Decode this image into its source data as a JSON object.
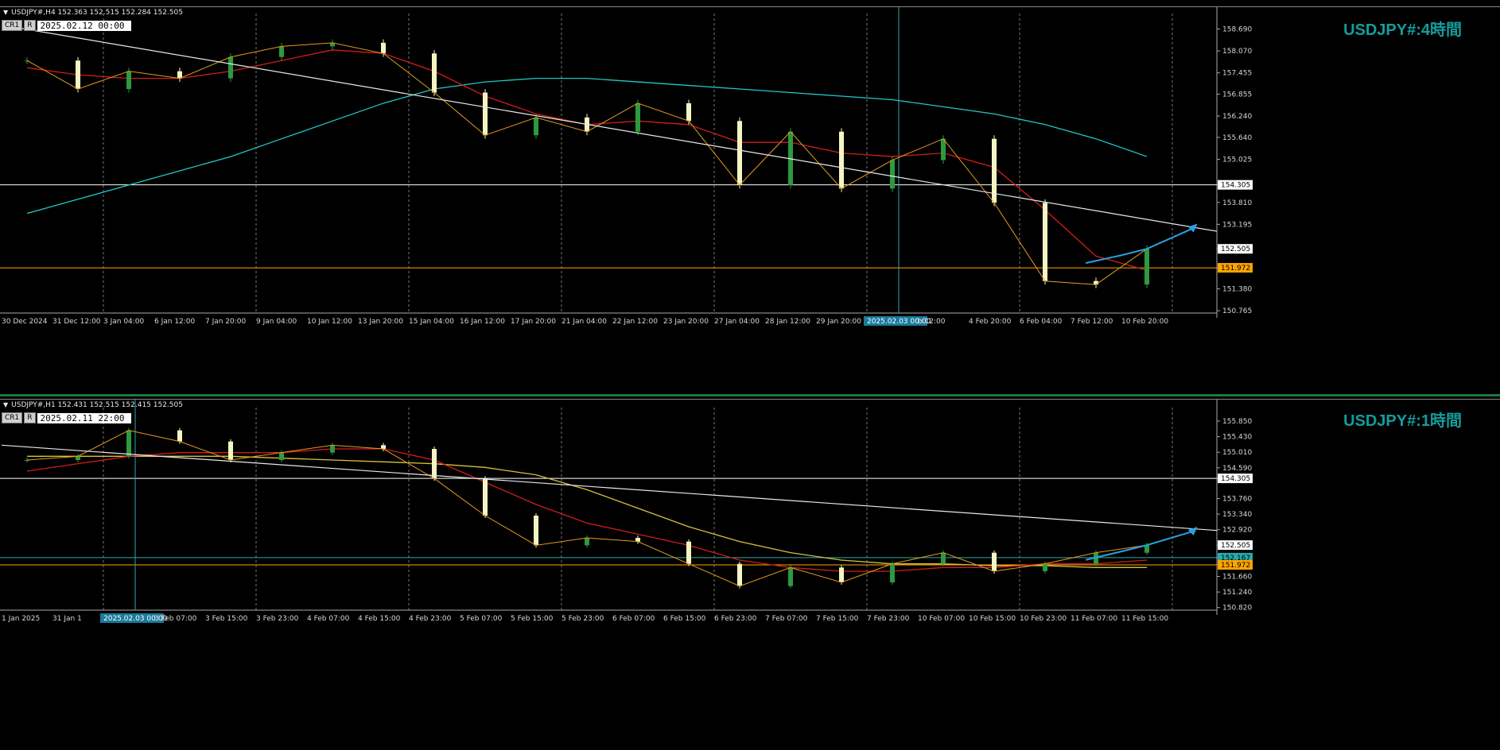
{
  "panes": [
    {
      "id": "h4",
      "symbol_header": "USDJPY#,H4  152.363 152.515 152.284 152.505",
      "buttons": [
        "CR1",
        "R"
      ],
      "datetime": "2025.02.12 00:00",
      "watermark": "USDJPY#:4時間",
      "current_price": "152.505",
      "price_ticks": [
        "158.690",
        "158.070",
        "157.455",
        "156.855",
        "156.240",
        "155.640",
        "155.025",
        "154.305",
        "153.810",
        "153.195",
        "152.505",
        "151.972",
        "151.380",
        "150.765"
      ],
      "time_labels": [
        "30 Dec 2024",
        "31 Dec 12:00",
        "3 Jan 04:00",
        "6 Jan 12:00",
        "7 Jan 20:00",
        "9 Jan 04:00",
        "10 Jan 12:00",
        "13 Jan 20:00",
        "15 Jan 04:00",
        "16 Jan 12:00",
        "17 Jan 20:00",
        "21 Jan 04:00",
        "22 Jan 12:00",
        "23 Jan 20:00",
        "27 Jan 04:00",
        "28 Jan 12:00",
        "29 Jan 20:00",
        "2025.02.03 00:00",
        "b 12:00",
        "4 Feb 20:00",
        "6 Feb 04:00",
        "7 Feb 12:00",
        "10 Feb 20:00"
      ],
      "horizontal_levels": [
        {
          "label": "154.305",
          "color": "#ffffff"
        },
        {
          "label": "151.972",
          "color": "#ffa500"
        }
      ]
    },
    {
      "id": "h1",
      "symbol_header": "USDJPY#,H1  152.431 152.515 152.415 152.505",
      "buttons": [
        "CR1",
        "R"
      ],
      "datetime": "2025.02.11 22:00",
      "watermark": "USDJPY#:1時間",
      "current_price": "152.505",
      "price_ticks": [
        "155.850",
        "155.430",
        "155.010",
        "154.590",
        "154.305",
        "153.760",
        "153.340",
        "152.920",
        "152.505",
        "152.167",
        "151.972",
        "151.660",
        "151.240",
        "150.820"
      ],
      "time_labels": [
        "1 Jan 2025",
        "31 Jan 1",
        "2025.02.03 00:00",
        "3 Feb 07:00",
        "3 Feb 15:00",
        "3 Feb 23:00",
        "4 Feb 07:00",
        "4 Feb 15:00",
        "4 Feb 23:00",
        "5 Feb 07:00",
        "5 Feb 15:00",
        "5 Feb 23:00",
        "6 Feb 07:00",
        "6 Feb 15:00",
        "6 Feb 23:00",
        "7 Feb 07:00",
        "7 Feb 15:00",
        "7 Feb 23:00",
        "10 Feb 07:00",
        "10 Feb 15:00",
        "10 Feb 23:00",
        "11 Feb 07:00",
        "11 Feb 15:00"
      ],
      "horizontal_levels": [
        {
          "label": "154.305",
          "color": "#ffffff"
        },
        {
          "label": "152.167",
          "color": "#2aa9a9"
        },
        {
          "label": "151.972",
          "color": "#ffa500"
        }
      ]
    }
  ],
  "chart_data": [
    {
      "type": "candlestick",
      "title": "USDJPY#:4時間",
      "ylim": [
        150.7,
        158.9
      ],
      "grid": true,
      "x": [
        "30 Dec 2024",
        "31 Dec 12:00",
        "3 Jan 04:00",
        "6 Jan 12:00",
        "7 Jan 20:00",
        "9 Jan 04:00",
        "10 Jan 12:00",
        "13 Jan 20:00",
        "15 Jan 04:00",
        "16 Jan 12:00",
        "17 Jan 20:00",
        "21 Jan 04:00",
        "22 Jan 12:00",
        "23 Jan 20:00",
        "27 Jan 04:00",
        "28 Jan 12:00",
        "29 Jan 20:00",
        "2025.02.03 00:00",
        "b 12:00",
        "4 Feb 20:00",
        "6 Feb 04:00",
        "7 Feb 12:00",
        "10 Feb 20:00"
      ],
      "close": [
        157.8,
        157.0,
        157.5,
        157.3,
        157.9,
        158.2,
        158.3,
        158.0,
        156.9,
        155.7,
        156.2,
        155.8,
        156.6,
        156.1,
        154.3,
        155.8,
        154.2,
        155.0,
        155.6,
        153.8,
        151.6,
        151.5,
        152.505
      ],
      "ma_red": [
        157.6,
        157.4,
        157.3,
        157.3,
        157.5,
        157.8,
        158.1,
        158.0,
        157.5,
        156.8,
        156.3,
        156.0,
        156.1,
        156.0,
        155.5,
        155.5,
        155.2,
        155.1,
        155.2,
        154.8,
        153.6,
        152.3,
        151.9
      ],
      "ma_cyan": [
        153.5,
        153.9,
        154.3,
        154.7,
        155.1,
        155.6,
        156.1,
        156.6,
        157.0,
        157.2,
        157.3,
        157.3,
        157.2,
        157.1,
        157.0,
        156.9,
        156.8,
        156.7,
        156.5,
        156.3,
        156.0,
        155.6,
        155.1
      ],
      "trend_line": [
        [
          0,
          158.8
        ],
        [
          24,
          153.0
        ]
      ]
    },
    {
      "type": "candlestick",
      "title": "USDJPY#:1時間",
      "ylim": [
        150.75,
        156.0
      ],
      "grid": true,
      "x": [
        "1 Jan 2025",
        "31 Jan 1",
        "2025.02.03 00:00",
        "3 Feb 07:00",
        "3 Feb 15:00",
        "3 Feb 23:00",
        "4 Feb 07:00",
        "4 Feb 15:00",
        "4 Feb 23:00",
        "5 Feb 07:00",
        "5 Feb 15:00",
        "5 Feb 23:00",
        "6 Feb 07:00",
        "6 Feb 15:00",
        "6 Feb 23:00",
        "7 Feb 07:00",
        "7 Feb 15:00",
        "7 Feb 23:00",
        "10 Feb 07:00",
        "10 Feb 15:00",
        "10 Feb 23:00",
        "11 Feb 07:00",
        "11 Feb 15:00"
      ],
      "close": [
        154.8,
        154.9,
        155.6,
        155.3,
        154.8,
        155.0,
        155.2,
        155.1,
        154.3,
        153.3,
        152.5,
        152.7,
        152.6,
        152.0,
        151.4,
        151.9,
        151.5,
        152.0,
        152.3,
        151.8,
        152.0,
        152.3,
        152.505
      ],
      "ma_red": [
        154.5,
        154.7,
        154.9,
        155.0,
        155.0,
        155.0,
        155.1,
        155.1,
        154.8,
        154.2,
        153.6,
        153.1,
        152.8,
        152.5,
        152.1,
        151.9,
        151.8,
        151.8,
        151.9,
        151.9,
        152.0,
        152.0,
        152.1
      ],
      "ma_yellow": [
        154.9,
        154.9,
        154.9,
        154.9,
        154.9,
        154.85,
        154.8,
        154.75,
        154.7,
        154.6,
        154.4,
        154.0,
        153.5,
        153.0,
        152.6,
        152.3,
        152.1,
        152.0,
        152.0,
        151.95,
        151.95,
        151.9,
        151.9
      ],
      "trend_line": [
        [
          0,
          155.2
        ],
        [
          28,
          152.9
        ]
      ]
    }
  ]
}
